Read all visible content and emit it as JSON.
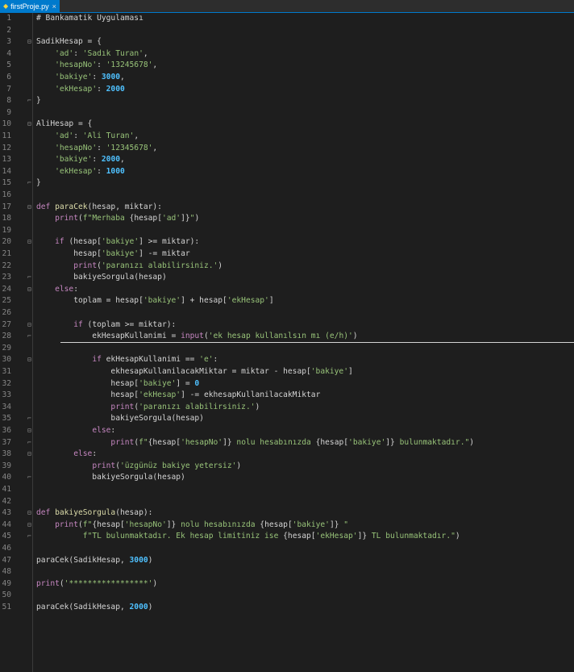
{
  "tab": {
    "filename": "firstProje.py",
    "close": "×"
  },
  "lines": [
    {
      "n": "1",
      "fold": "",
      "tokens": [
        [
          "cm",
          "# Bankamatik Uygulaması"
        ]
      ]
    },
    {
      "n": "2",
      "fold": "",
      "tokens": []
    },
    {
      "n": "3",
      "fold": "open",
      "tokens": [
        [
          "plain",
          "SadikHesap = {"
        ]
      ]
    },
    {
      "n": "4",
      "fold": "",
      "tokens": [
        [
          "plain",
          "    "
        ],
        [
          "str",
          "'ad'"
        ],
        [
          "plain",
          ": "
        ],
        [
          "str",
          "'Sadık Turan'"
        ],
        [
          "plain",
          ","
        ]
      ]
    },
    {
      "n": "5",
      "fold": "",
      "tokens": [
        [
          "plain",
          "    "
        ],
        [
          "str",
          "'hesapNo'"
        ],
        [
          "plain",
          ": "
        ],
        [
          "str",
          "'13245678'"
        ],
        [
          "plain",
          ","
        ]
      ]
    },
    {
      "n": "6",
      "fold": "",
      "tokens": [
        [
          "plain",
          "    "
        ],
        [
          "str",
          "'bakiye'"
        ],
        [
          "plain",
          ": "
        ],
        [
          "num",
          "3000"
        ],
        [
          "plain",
          ","
        ]
      ]
    },
    {
      "n": "7",
      "fold": "",
      "tokens": [
        [
          "plain",
          "    "
        ],
        [
          "str",
          "'ekHesap'"
        ],
        [
          "plain",
          ": "
        ],
        [
          "num",
          "2000"
        ]
      ]
    },
    {
      "n": "8",
      "fold": "end",
      "tokens": [
        [
          "plain",
          "}"
        ]
      ]
    },
    {
      "n": "9",
      "fold": "",
      "tokens": []
    },
    {
      "n": "10",
      "fold": "open",
      "tokens": [
        [
          "plain",
          "AliHesap = {"
        ]
      ]
    },
    {
      "n": "11",
      "fold": "",
      "tokens": [
        [
          "plain",
          "    "
        ],
        [
          "str",
          "'ad'"
        ],
        [
          "plain",
          ": "
        ],
        [
          "str",
          "'Ali Turan'"
        ],
        [
          "plain",
          ","
        ]
      ]
    },
    {
      "n": "12",
      "fold": "",
      "tokens": [
        [
          "plain",
          "    "
        ],
        [
          "str",
          "'hesapNo'"
        ],
        [
          "plain",
          ": "
        ],
        [
          "str",
          "'12345678'"
        ],
        [
          "plain",
          ","
        ]
      ]
    },
    {
      "n": "13",
      "fold": "",
      "tokens": [
        [
          "plain",
          "    "
        ],
        [
          "str",
          "'bakiye'"
        ],
        [
          "plain",
          ": "
        ],
        [
          "num",
          "2000"
        ],
        [
          "plain",
          ","
        ]
      ]
    },
    {
      "n": "14",
      "fold": "",
      "tokens": [
        [
          "plain",
          "    "
        ],
        [
          "str",
          "'ekHesap'"
        ],
        [
          "plain",
          ": "
        ],
        [
          "num",
          "1000"
        ]
      ]
    },
    {
      "n": "15",
      "fold": "end",
      "tokens": [
        [
          "plain",
          "}"
        ]
      ]
    },
    {
      "n": "16",
      "fold": "",
      "tokens": []
    },
    {
      "n": "17",
      "fold": "open",
      "tokens": [
        [
          "kw",
          "def"
        ],
        [
          "plain",
          " "
        ],
        [
          "fn",
          "paraCek"
        ],
        [
          "plain",
          "(hesap, miktar):"
        ]
      ]
    },
    {
      "n": "18",
      "fold": "",
      "tokens": [
        [
          "plain",
          "    "
        ],
        [
          "builtin",
          "print"
        ],
        [
          "plain",
          "("
        ],
        [
          "str",
          "f\"Merhaba "
        ],
        [
          "plain",
          "{hesap["
        ],
        [
          "str",
          "'ad'"
        ],
        [
          "plain",
          "]}"
        ],
        [
          "str",
          "\""
        ],
        [
          "plain",
          ")"
        ]
      ]
    },
    {
      "n": "19",
      "fold": "",
      "tokens": []
    },
    {
      "n": "20",
      "fold": "open",
      "tokens": [
        [
          "plain",
          "    "
        ],
        [
          "kw",
          "if"
        ],
        [
          "plain",
          " (hesap["
        ],
        [
          "str",
          "'bakiye'"
        ],
        [
          "plain",
          "] >= miktar):"
        ]
      ]
    },
    {
      "n": "21",
      "fold": "",
      "tokens": [
        [
          "plain",
          "        hesap["
        ],
        [
          "str",
          "'bakiye'"
        ],
        [
          "plain",
          "] -= miktar"
        ]
      ]
    },
    {
      "n": "22",
      "fold": "",
      "tokens": [
        [
          "plain",
          "        "
        ],
        [
          "builtin",
          "print"
        ],
        [
          "plain",
          "("
        ],
        [
          "str",
          "'paranızı alabilirsiniz.'"
        ],
        [
          "plain",
          ")"
        ]
      ]
    },
    {
      "n": "23",
      "fold": "end",
      "tokens": [
        [
          "plain",
          "        bakiyeSorgula(hesap)"
        ]
      ]
    },
    {
      "n": "24",
      "fold": "open",
      "tokens": [
        [
          "plain",
          "    "
        ],
        [
          "kw",
          "else"
        ],
        [
          "plain",
          ":"
        ]
      ]
    },
    {
      "n": "25",
      "fold": "",
      "tokens": [
        [
          "plain",
          "        toplam = hesap["
        ],
        [
          "str",
          "'bakiye'"
        ],
        [
          "plain",
          "] + hesap["
        ],
        [
          "str",
          "'ekHesap'"
        ],
        [
          "plain",
          "]"
        ]
      ]
    },
    {
      "n": "26",
      "fold": "",
      "tokens": []
    },
    {
      "n": "27",
      "fold": "open",
      "tokens": [
        [
          "plain",
          "        "
        ],
        [
          "kw",
          "if"
        ],
        [
          "plain",
          " (toplam >= miktar):"
        ]
      ]
    },
    {
      "n": "28",
      "fold": "end",
      "tokens": [
        [
          "plain",
          "            ekHesapKullanimi = "
        ],
        [
          "builtin",
          "input"
        ],
        [
          "plain",
          "("
        ],
        [
          "str",
          "'ek hesap kullanılsın mı (e/h)'"
        ],
        [
          "plain",
          ")"
        ]
      ]
    },
    {
      "n": "29",
      "fold": "",
      "tokens": []
    },
    {
      "n": "30",
      "fold": "open",
      "tokens": [
        [
          "plain",
          "            "
        ],
        [
          "kw",
          "if"
        ],
        [
          "plain",
          " ekHesapKullanimi == "
        ],
        [
          "str",
          "'e'"
        ],
        [
          "plain",
          ":"
        ]
      ]
    },
    {
      "n": "31",
      "fold": "",
      "tokens": [
        [
          "plain",
          "                ekhesapKullanilacakMiktar = miktar - hesap["
        ],
        [
          "str",
          "'bakiye'"
        ],
        [
          "plain",
          "]"
        ]
      ]
    },
    {
      "n": "32",
      "fold": "",
      "tokens": [
        [
          "plain",
          "                hesap["
        ],
        [
          "str",
          "'bakiye'"
        ],
        [
          "plain",
          "] = "
        ],
        [
          "num",
          "0"
        ]
      ]
    },
    {
      "n": "33",
      "fold": "",
      "tokens": [
        [
          "plain",
          "                hesap["
        ],
        [
          "str",
          "'ekHesap'"
        ],
        [
          "plain",
          "] -= ekhesapKullanilacakMiktar"
        ]
      ]
    },
    {
      "n": "34",
      "fold": "",
      "tokens": [
        [
          "plain",
          "                "
        ],
        [
          "builtin",
          "print"
        ],
        [
          "plain",
          "("
        ],
        [
          "str",
          "'paranızı alabilirsiniz.'"
        ],
        [
          "plain",
          ")"
        ]
      ]
    },
    {
      "n": "35",
      "fold": "end",
      "tokens": [
        [
          "plain",
          "                bakiyeSorgula(hesap)"
        ]
      ]
    },
    {
      "n": "36",
      "fold": "open",
      "tokens": [
        [
          "plain",
          "            "
        ],
        [
          "kw",
          "else"
        ],
        [
          "plain",
          ":"
        ]
      ]
    },
    {
      "n": "37",
      "fold": "end",
      "tokens": [
        [
          "plain",
          "                "
        ],
        [
          "builtin",
          "print"
        ],
        [
          "plain",
          "("
        ],
        [
          "str",
          "f\""
        ],
        [
          "plain",
          "{hesap["
        ],
        [
          "str",
          "'hesapNo'"
        ],
        [
          "plain",
          "]}"
        ],
        [
          "str",
          " nolu hesabınızda "
        ],
        [
          "plain",
          "{hesap["
        ],
        [
          "str",
          "'bakiye'"
        ],
        [
          "plain",
          "]}"
        ],
        [
          "str",
          " bulunmaktadır.\""
        ],
        [
          "plain",
          ")"
        ]
      ]
    },
    {
      "n": "38",
      "fold": "open",
      "tokens": [
        [
          "plain",
          "        "
        ],
        [
          "kw",
          "else"
        ],
        [
          "plain",
          ":"
        ]
      ]
    },
    {
      "n": "39",
      "fold": "",
      "tokens": [
        [
          "plain",
          "            "
        ],
        [
          "builtin",
          "print"
        ],
        [
          "plain",
          "("
        ],
        [
          "str",
          "'üzgünüz bakiye yetersiz'"
        ],
        [
          "plain",
          ")"
        ]
      ]
    },
    {
      "n": "40",
      "fold": "end",
      "tokens": [
        [
          "plain",
          "            bakiyeSorgula(hesap)"
        ]
      ]
    },
    {
      "n": "41",
      "fold": "",
      "tokens": []
    },
    {
      "n": "42",
      "fold": "",
      "tokens": []
    },
    {
      "n": "43",
      "fold": "open",
      "tokens": [
        [
          "kw",
          "def"
        ],
        [
          "plain",
          " "
        ],
        [
          "fn",
          "bakiyeSorgula"
        ],
        [
          "plain",
          "(hesap):"
        ]
      ]
    },
    {
      "n": "44",
      "fold": "open",
      "tokens": [
        [
          "plain",
          "    "
        ],
        [
          "builtin",
          "print"
        ],
        [
          "plain",
          "("
        ],
        [
          "str",
          "f\""
        ],
        [
          "plain",
          "{hesap["
        ],
        [
          "str",
          "'hesapNo'"
        ],
        [
          "plain",
          "]}"
        ],
        [
          "str",
          " nolu hesabınızda "
        ],
        [
          "plain",
          "{hesap["
        ],
        [
          "str",
          "'bakiye'"
        ],
        [
          "plain",
          "]}"
        ],
        [
          "str",
          " \""
        ]
      ]
    },
    {
      "n": "45",
      "fold": "end",
      "tokens": [
        [
          "plain",
          "          "
        ],
        [
          "str",
          "f\"TL bulunmaktadır. Ek hesap limitiniz ise "
        ],
        [
          "plain",
          "{hesap["
        ],
        [
          "str",
          "'ekHesap'"
        ],
        [
          "plain",
          "]}"
        ],
        [
          "str",
          " TL bulunmaktadır.\""
        ],
        [
          "plain",
          ")"
        ]
      ]
    },
    {
      "n": "46",
      "fold": "",
      "tokens": []
    },
    {
      "n": "47",
      "fold": "",
      "tokens": [
        [
          "plain",
          "paraCek(SadikHesap, "
        ],
        [
          "num",
          "3000"
        ],
        [
          "plain",
          ")"
        ]
      ]
    },
    {
      "n": "48",
      "fold": "",
      "tokens": []
    },
    {
      "n": "49",
      "fold": "",
      "tokens": [
        [
          "builtin",
          "print"
        ],
        [
          "plain",
          "("
        ],
        [
          "str",
          "'*****************'"
        ],
        [
          "plain",
          ")"
        ]
      ]
    },
    {
      "n": "50",
      "fold": "",
      "tokens": []
    },
    {
      "n": "51",
      "fold": "",
      "tokens": [
        [
          "plain",
          "paraCek(SadikHesap, "
        ],
        [
          "num",
          "2000"
        ],
        [
          "plain",
          ")"
        ]
      ]
    }
  ]
}
